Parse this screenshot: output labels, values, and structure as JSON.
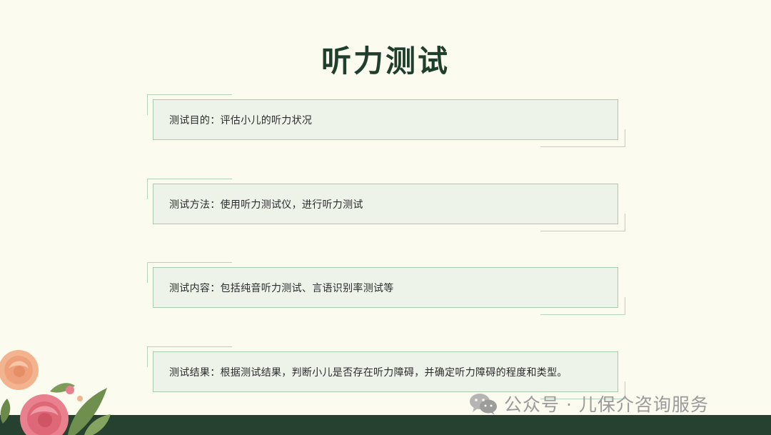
{
  "slide": {
    "title": "听力测试",
    "items": [
      {
        "text": "测试目的：评估小儿的听力状况"
      },
      {
        "text": "测试方法：使用听力测试仪，进行听力测试"
      },
      {
        "text": "测试内容：包括纯音听力测试、言语识别率测试等"
      },
      {
        "text": "测试结果：根据测试结果，判断小儿是否存在听力障碍，并确定听力障碍的程度和类型。"
      }
    ]
  },
  "watermark": {
    "text": "公众号 · 儿保介咨询服务",
    "icon": "wechat-icon"
  },
  "decoration": {
    "icon": "flower-bouquet-icon"
  },
  "colors": {
    "background": "#fcfbf0",
    "title": "#1f3f2c",
    "box_fill": "#eef3ea",
    "box_border": "#a9ccb1",
    "footer_bar": "#26412f",
    "watermark": "#9a9a9a"
  }
}
